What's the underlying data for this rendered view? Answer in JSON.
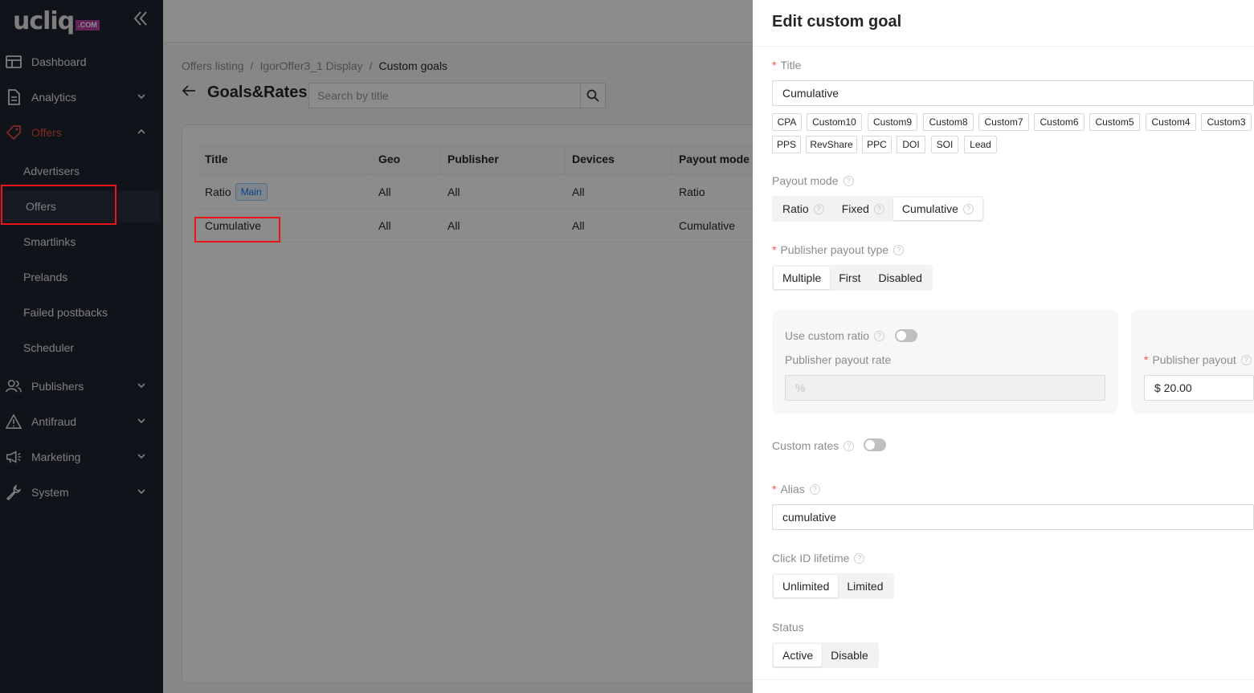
{
  "logo": {
    "text": "ucliq",
    "suffix": ".COM"
  },
  "sidebar": {
    "items": [
      {
        "label": "Dashboard"
      },
      {
        "label": "Analytics"
      },
      {
        "label": "Offers"
      },
      {
        "label": "Publishers"
      },
      {
        "label": "Antifraud"
      },
      {
        "label": "Marketing"
      },
      {
        "label": "System"
      }
    ],
    "offers_sub": [
      {
        "label": "Advertisers"
      },
      {
        "label": "Offers"
      },
      {
        "label": "Smartlinks"
      },
      {
        "label": "Prelands"
      },
      {
        "label": "Failed postbacks"
      },
      {
        "label": "Scheduler"
      }
    ]
  },
  "breadcrumb": {
    "items": [
      "Offers listing",
      "IgorOffer3_1 Display",
      "Custom goals"
    ],
    "sep": "/"
  },
  "page": {
    "title": "Goals&Rates",
    "search_placeholder": "Search by title"
  },
  "table": {
    "headers": [
      "Title",
      "Geo",
      "Publisher",
      "Devices",
      "Payout mode"
    ],
    "rows": [
      {
        "title": "Ratio",
        "tag": "Main",
        "geo": "All",
        "publisher": "All",
        "devices": "All",
        "payout_mode": "Ratio"
      },
      {
        "title": "Cumulative",
        "tag": "",
        "geo": "All",
        "publisher": "All",
        "devices": "All",
        "payout_mode": "Cumulative"
      }
    ]
  },
  "drawer": {
    "title": "Edit custom goal",
    "title_label": "Title",
    "title_value": "Cumulative",
    "chips": [
      "CPA",
      "Custom10",
      "Custom9",
      "Custom8",
      "Custom7",
      "Custom6",
      "Custom5",
      "Custom4",
      "Custom3",
      "PPS",
      "RevShare",
      "PPC",
      "DOI",
      "SOI",
      "Lead"
    ],
    "payout_mode": {
      "label": "Payout mode",
      "options": [
        "Ratio",
        "Fixed",
        "Cumulative"
      ],
      "selected": "Cumulative"
    },
    "publisher_payout_type": {
      "label": "Publisher payout type",
      "options": [
        "Multiple",
        "First",
        "Disabled"
      ],
      "selected": "Multiple"
    },
    "use_custom_ratio": {
      "label": "Use custom ratio",
      "enabled": false
    },
    "publisher_payout_rate": {
      "label": "Publisher payout rate",
      "placeholder": "%"
    },
    "publisher_payout": {
      "label": "Publisher payout",
      "value": "$ 20.00"
    },
    "custom_rates": {
      "label": "Custom rates",
      "enabled": false
    },
    "alias": {
      "label": "Alias",
      "value": "cumulative"
    },
    "click_id_lifetime": {
      "label": "Click ID lifetime",
      "options": [
        "Unlimited",
        "Limited"
      ],
      "selected": "Unlimited"
    },
    "status": {
      "label": "Status",
      "options": [
        "Active",
        "Disable"
      ],
      "selected": "Active"
    }
  },
  "colors": {
    "sidebar_bg": "#1f2330",
    "accent": "#e0503c",
    "highlight_box": "#e8151b"
  }
}
